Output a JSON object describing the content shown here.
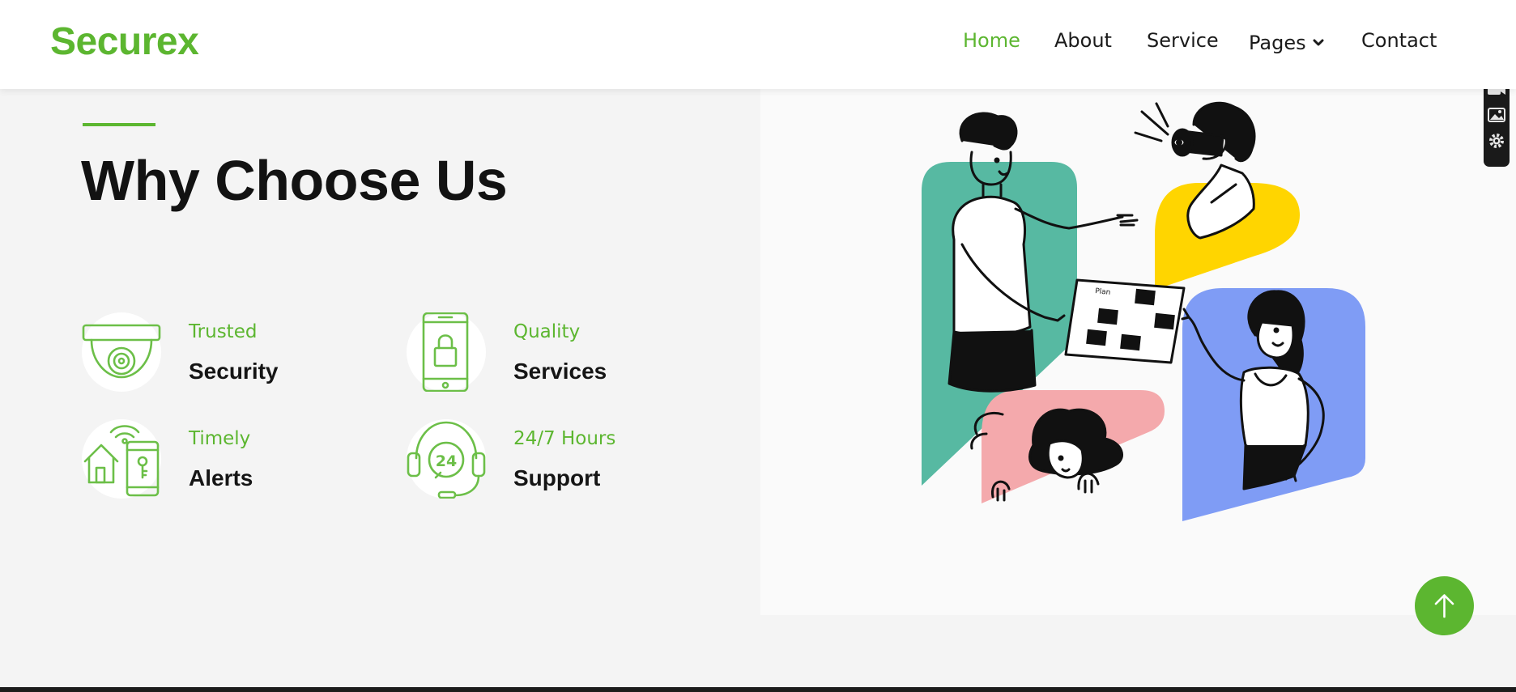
{
  "brand": {
    "name": "Securex"
  },
  "nav": {
    "items": [
      {
        "label": "Home",
        "active": true
      },
      {
        "label": "About",
        "active": false
      },
      {
        "label": "Service",
        "active": false
      },
      {
        "label": "Pages",
        "active": false,
        "has_dropdown": true
      },
      {
        "label": "Contact",
        "active": false
      }
    ]
  },
  "section": {
    "title": "Why Choose Us"
  },
  "features": [
    {
      "subtitle": "Trusted",
      "title": "Security",
      "icon": "cctv-camera-icon"
    },
    {
      "subtitle": "Quality",
      "title": "Services",
      "icon": "smartphone-lock-icon"
    },
    {
      "subtitle": "Timely",
      "title": "Alerts",
      "icon": "smart-home-alert-icon"
    },
    {
      "subtitle": "24/7 Hours",
      "title": "Support",
      "icon": "headset-24-icon"
    }
  ],
  "widget": {
    "buttons": [
      "camera-icon",
      "video-icon",
      "image-icon",
      "gear-icon"
    ]
  },
  "scroll_top": {
    "icon": "arrow-up-icon"
  },
  "colors": {
    "accent": "#5cb630",
    "heading": "#121212",
    "background": "#f4f4f4",
    "illustration_green": "#57b9a2",
    "illustration_yellow": "#ffd500",
    "illustration_blue": "#7f9cf5",
    "illustration_pink": "#f4a9ac"
  }
}
